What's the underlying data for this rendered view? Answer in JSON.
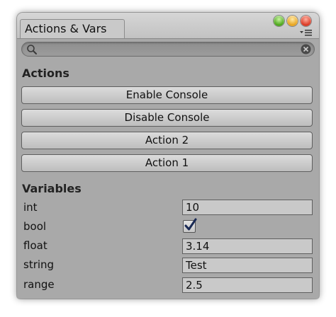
{
  "window": {
    "tab_title": "Actions & Vars"
  },
  "search": {
    "placeholder": "",
    "value": ""
  },
  "actions": {
    "section_label": "Actions",
    "buttons": [
      {
        "label": "Enable Console"
      },
      {
        "label": "Disable Console"
      },
      {
        "label": "Action 2"
      },
      {
        "label": "Action 1"
      }
    ]
  },
  "variables": {
    "section_label": "Variables",
    "items": [
      {
        "label": "int",
        "type": "text",
        "value": "10"
      },
      {
        "label": "bool",
        "type": "checkbox",
        "checked": true
      },
      {
        "label": "float",
        "type": "text",
        "value": "3.14"
      },
      {
        "label": "string",
        "type": "text",
        "value": "Test"
      },
      {
        "label": "range",
        "type": "text",
        "value": "2.5"
      }
    ]
  },
  "icons": {
    "traffic_lights": [
      "green-zoom-icon",
      "yellow-minimize-icon",
      "red-close-icon"
    ],
    "menu": "dropdown-menu-icon",
    "search": "magnifier-icon",
    "clear": "clear-search-icon",
    "checkmark": "checkmark-icon"
  },
  "colors": {
    "window_bg": "#a9a9a9",
    "button_bg": "#cfcfcf",
    "field_bg": "#c9c9c9",
    "checkmark": "#1a2a55"
  }
}
